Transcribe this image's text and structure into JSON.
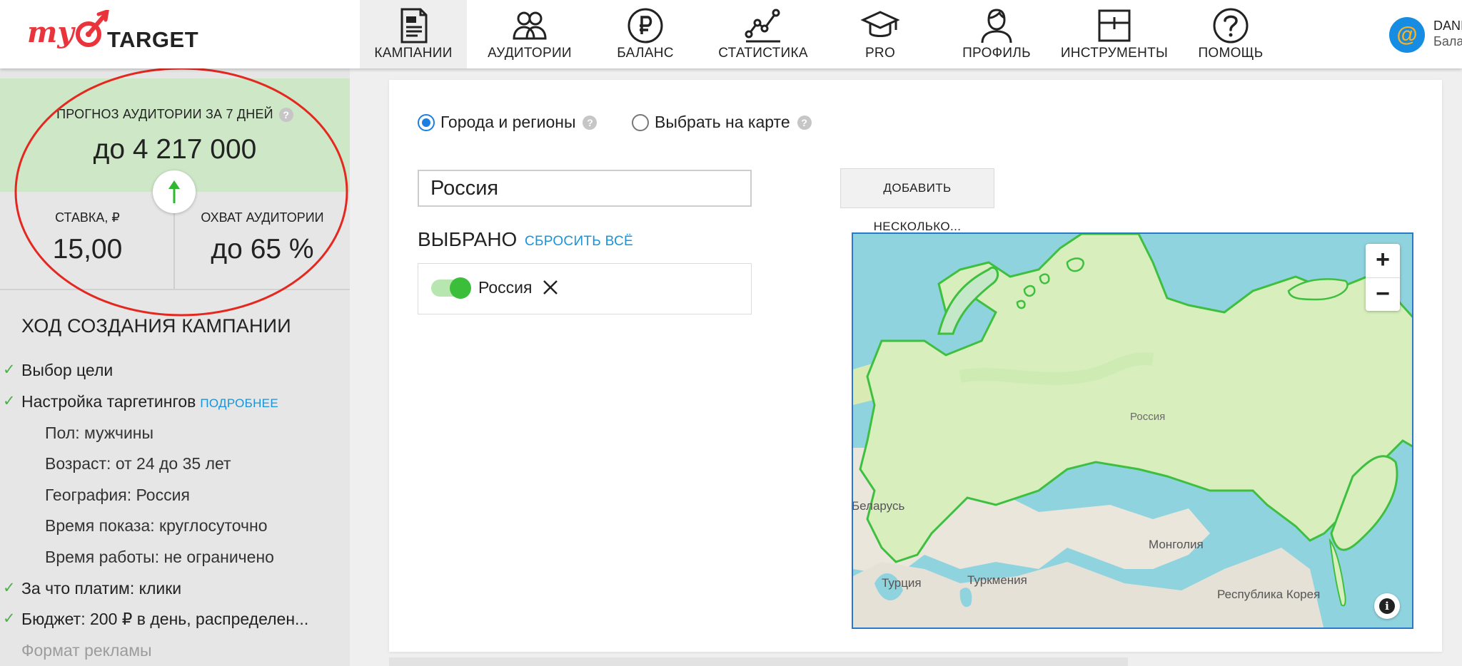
{
  "brand": {
    "logo_my": "my",
    "logo_word": "TARGET"
  },
  "nav": [
    {
      "label": "КАМПАНИИ",
      "icon": "campaign-document-icon",
      "active": true
    },
    {
      "label": "АУДИТОРИИ",
      "icon": "audience-people-icon"
    },
    {
      "label": "БАЛАНС",
      "icon": "ruble-coin-icon"
    },
    {
      "label": "СТАТИСТИКА",
      "icon": "line-chart-icon"
    },
    {
      "label": "PRO",
      "icon": "graduation-cap-icon"
    },
    {
      "label": "ПРОФИЛЬ",
      "icon": "user-profile-icon"
    },
    {
      "label": "ИНСТРУМЕНТЫ",
      "icon": "tools-box-icon"
    },
    {
      "label": "ПОМОЩЬ",
      "icon": "help-question-icon"
    }
  ],
  "user": {
    "avatar_glyph": "@",
    "name": "DANI",
    "balance": "Бала"
  },
  "sidebar": {
    "forecast": {
      "title": "ПРОГНОЗ АУДИТОРИИ ЗА 7 ДНЕЙ",
      "help": "?",
      "value": "до 4 217 000"
    },
    "rate": {
      "label": "СТАВКА, ₽",
      "value": "15,00"
    },
    "reach": {
      "label": "ОХВАТ АУДИТОРИИ",
      "value": "до 65 %"
    },
    "progress_title": "ХОД СОЗДАНИЯ КАМПАНИИ",
    "steps": {
      "goal": "Выбор цели",
      "targeting": "Настройка таргетингов",
      "targeting_link": "ПОДРОБНЕЕ",
      "sex": "Пол: мужчины",
      "age": "Возраст: от 24 до 35 лет",
      "geo": "География: Россия",
      "showtime": "Время показа: круглосуточно",
      "worktime": "Время работы: не ограничено",
      "pay": "За что платим: клики",
      "budget": "Бюджет: 200 ₽ в день, распределен...",
      "format": "Формат рекламы"
    }
  },
  "geo": {
    "radio_regions": "Города и регионы",
    "radio_map": "Выбрать на карте",
    "help": "?",
    "search_value": "Россия",
    "add_button": "ДОБАВИТЬ НЕСКОЛЬКО...",
    "selected_title": "ВЫБРАНО",
    "reset": "СБРОСИТЬ ВСЁ",
    "chip_label": "Россия",
    "map": {
      "zoom_in": "+",
      "zoom_out": "−",
      "info": "i",
      "labels": {
        "russia": "Россия",
        "belarus": "Беларусь",
        "mongolia": "Монголия",
        "turkey": "Турция",
        "turkmenistan": "Туркмения",
        "korea": "Республика Корея"
      }
    }
  },
  "colors": {
    "accent_blue": "#1a93d8",
    "forecast_green": "#cde7c7",
    "check_green": "#4cae4c",
    "map_water": "#8fd3df",
    "map_russia": "#d8efbd",
    "map_border": "#3fbf3f"
  }
}
